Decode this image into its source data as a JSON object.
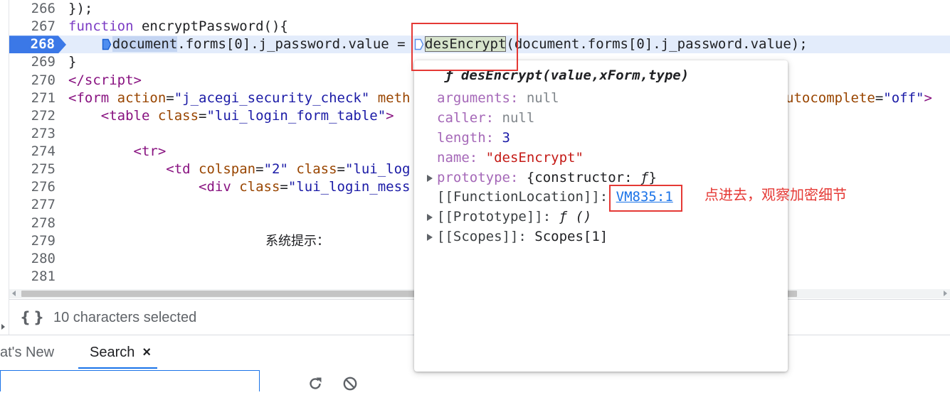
{
  "colors": {
    "accent": "#1a73e8",
    "paused_line_marker": "#3b78e7",
    "paused_line_background": "#e3ecfb",
    "annotation_red": "#e53935"
  },
  "editor": {
    "lines": [
      {
        "num": "266",
        "tokens": [
          {
            "t": "});",
            "kind": "plain"
          }
        ]
      },
      {
        "num": "267",
        "tokens": [
          {
            "t": "function",
            "kind": "keyword"
          },
          {
            "t": " encryptPassword(){",
            "kind": "plain"
          }
        ]
      },
      {
        "num": "268",
        "current": true,
        "tokens": [
          {
            "t": "    ",
            "kind": "plain"
          },
          {
            "icon": "inline-breakpoint-icon",
            "state": "active"
          },
          {
            "t": "document",
            "kind": "plain",
            "highlight": "selected"
          },
          {
            "t": ".forms[0].j_password.value = ",
            "kind": "plain"
          },
          {
            "icon": "inline-breakpoint-icon",
            "state": "inactive"
          },
          {
            "t": "desEncrypt",
            "kind": "plain",
            "highlight": "hovered"
          },
          {
            "t": "(document.forms[0].j_password.value);",
            "kind": "plain"
          }
        ]
      },
      {
        "num": "269",
        "tokens": [
          {
            "t": "}",
            "kind": "plain"
          }
        ]
      },
      {
        "num": "270",
        "tokens": [
          {
            "t": "</script>",
            "kind": "tag"
          }
        ]
      },
      {
        "num": "271",
        "tokens": [
          {
            "t": "<form",
            "kind": "tag"
          },
          {
            "t": " action",
            "kind": "attr-name"
          },
          {
            "t": "=",
            "kind": "plain"
          },
          {
            "t": "\"j_acegi_security_check\"",
            "kind": "attr-value"
          },
          {
            "t": " meth",
            "kind": "attr-name"
          }
        ],
        "tail": [
          {
            "t": "utocomplete",
            "kind": "attr-name"
          },
          {
            "t": "=",
            "kind": "plain"
          },
          {
            "t": "\"off\"",
            "kind": "attr-value"
          },
          {
            "t": ">",
            "kind": "tag"
          }
        ]
      },
      {
        "num": "272",
        "tokens": [
          {
            "t": "    <table",
            "kind": "tag"
          },
          {
            "t": " class",
            "kind": "attr-name"
          },
          {
            "t": "=",
            "kind": "plain"
          },
          {
            "t": "\"lui_login_form_table\"",
            "kind": "attr-value"
          },
          {
            "t": ">",
            "kind": "tag"
          }
        ]
      },
      {
        "num": "273",
        "tokens": []
      },
      {
        "num": "274",
        "tokens": [
          {
            "t": "        <tr>",
            "kind": "tag"
          }
        ]
      },
      {
        "num": "275",
        "tokens": [
          {
            "t": "            <td",
            "kind": "tag"
          },
          {
            "t": " colspan",
            "kind": "attr-name"
          },
          {
            "t": "=",
            "kind": "plain"
          },
          {
            "t": "\"2\"",
            "kind": "attr-value"
          },
          {
            "t": " class",
            "kind": "attr-name"
          },
          {
            "t": "=",
            "kind": "plain"
          },
          {
            "t": "\"lui_log",
            "kind": "attr-value"
          }
        ]
      },
      {
        "num": "276",
        "tokens": [
          {
            "t": "                <div",
            "kind": "tag"
          },
          {
            "t": " class",
            "kind": "attr-name"
          },
          {
            "t": "=",
            "kind": "plain"
          },
          {
            "t": "\"lui_login_mess",
            "kind": "attr-value"
          }
        ]
      },
      {
        "num": "277",
        "tokens": []
      },
      {
        "num": "278",
        "tokens": []
      },
      {
        "num": "279",
        "tokens": [],
        "tail": [
          {
            "t": "系统提示：",
            "kind": "text"
          }
        ]
      },
      {
        "num": "280",
        "tokens": []
      },
      {
        "num": "281",
        "tokens": []
      }
    ]
  },
  "popover": {
    "title_glyph": "ƒ",
    "title": "desEncrypt(value,xForm,type)",
    "sep": ": ",
    "props": {
      "arguments": {
        "key": "arguments",
        "value": "null"
      },
      "caller": {
        "key": "caller",
        "value": "null"
      },
      "length": {
        "key": "length",
        "value": "3"
      },
      "name": {
        "key": "name",
        "value": "\"desEncrypt\""
      },
      "prototype": {
        "key": "prototype",
        "value_pre": "{constructor: ",
        "value_fn": "ƒ",
        "value_post": "}"
      },
      "function_location": {
        "key": "[[FunctionLocation]]",
        "link": "VM835:1"
      },
      "proto_internal": {
        "key": "[[Prototype]]",
        "value_fn": "ƒ ()"
      },
      "scopes": {
        "key": "[[Scopes]]",
        "value": "Scopes[1]"
      }
    }
  },
  "annotation": {
    "note": "点进去，观察加密细节"
  },
  "status_bar": {
    "pretty_print_glyph": "{}",
    "pretty_print_icon": "curly-braces-icon",
    "selection_info": "10 characters selected"
  },
  "drawer": {
    "tabs": [
      {
        "label": "at's New"
      },
      {
        "label": "Search",
        "close_glyph": "×"
      }
    ]
  },
  "search_toolbar": {
    "input_value": "",
    "refresh_icon": "refresh-icon",
    "clear_icon": "clear-icon"
  }
}
